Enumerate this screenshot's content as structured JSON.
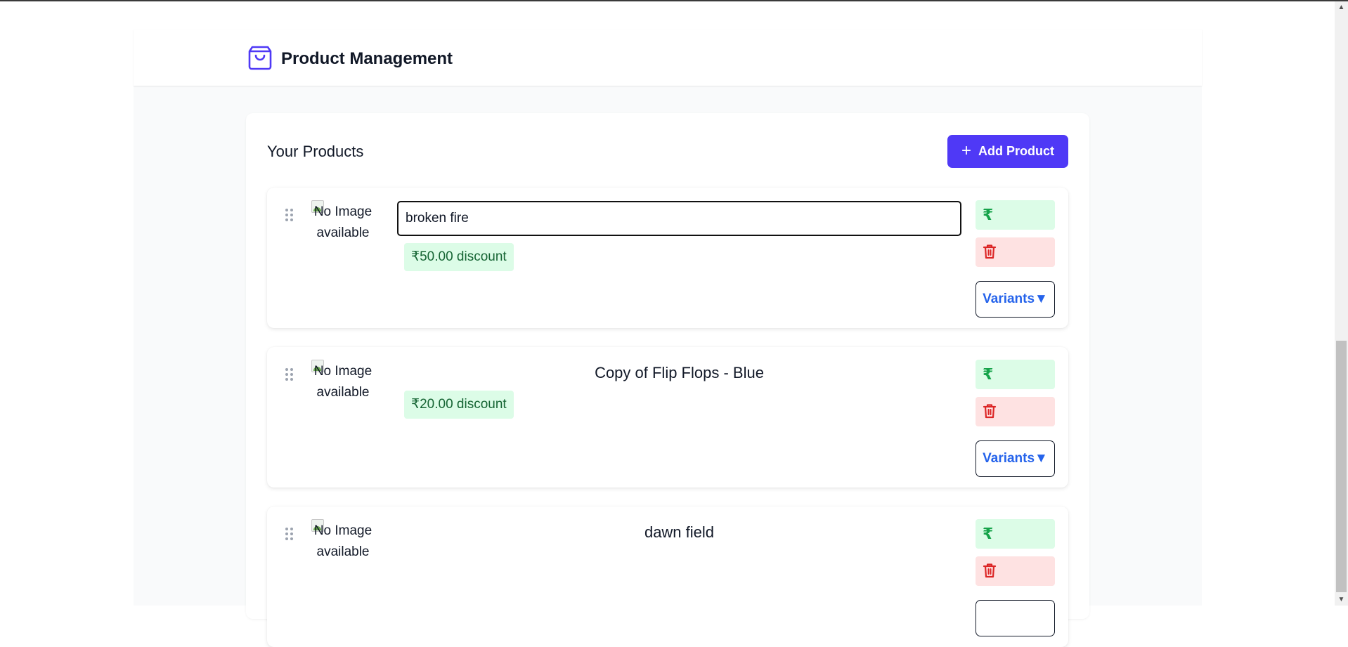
{
  "app": {
    "title": "Product Management",
    "brand_icon": "shopping-bag-icon",
    "accent": "#4f39f6"
  },
  "products_section": {
    "title": "Your Products",
    "add_button_label": "Add Product"
  },
  "products": [
    {
      "name": "broken fire",
      "editing": true,
      "image_alt": "No Image available",
      "discount": "₹50.00 discount",
      "price_icon_label": "₹",
      "variants_label": "Variants▼"
    },
    {
      "name": "Copy of Flip Flops - Blue",
      "editing": false,
      "image_alt": "No Image available",
      "discount": "₹20.00 discount",
      "price_icon_label": "₹",
      "variants_label": "Variants▼"
    },
    {
      "name": "dawn field",
      "editing": false,
      "image_alt": "No Image available",
      "price_icon_label": "₹",
      "variants_label": ""
    }
  ],
  "colors": {
    "discount_bg": "#dcfce7",
    "discount_text": "#166534",
    "delete_bg": "#fee2e2",
    "delete_icon": "#dc2626",
    "variants_text": "#2563eb"
  }
}
